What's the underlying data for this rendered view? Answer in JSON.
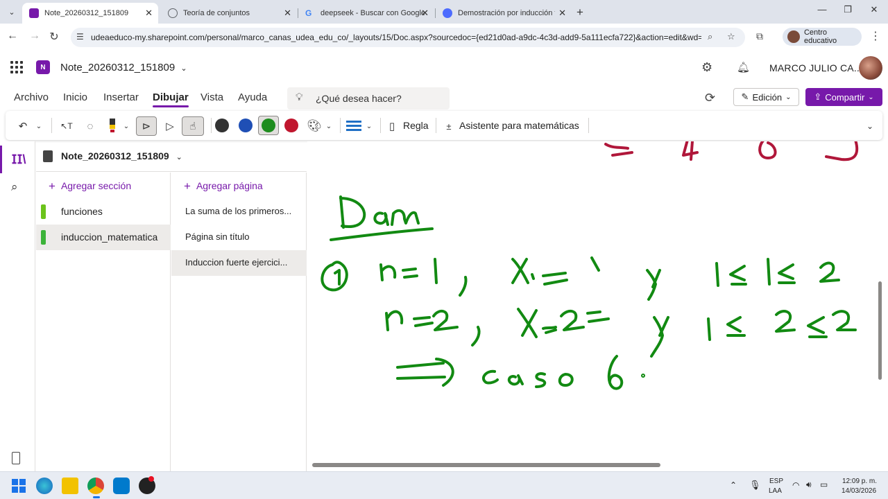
{
  "browser": {
    "tabs": [
      {
        "title": "Note_20260312_151809",
        "active": true,
        "favicon_color": "#7719aa"
      },
      {
        "title": "Teoría de conjuntos",
        "active": false,
        "favicon_color": "#5f6368"
      },
      {
        "title": "deepseek - Buscar con Google",
        "active": false,
        "favicon_color": "#4285f4"
      },
      {
        "title": "Demostración por inducción fu",
        "active": false,
        "favicon_color": "#4d6bfe"
      }
    ],
    "url": "udeaeduco-my.sharepoint.com/personal/marco_canas_udea_edu_co/_layouts/15/Doc.aspx?sourcedoc={ed21d0ad-a9dc-4c3d-add9-5a111ecfa722}&action=edit&wd=tar...",
    "profile_label": "Centro educativo"
  },
  "app": {
    "title": "Note_20260312_151809",
    "user_name": "MARCO JULIO CA...",
    "accent": "#7719aa"
  },
  "menu": {
    "items": [
      "Archivo",
      "Inicio",
      "Insertar",
      "Dibujar",
      "Vista",
      "Ayuda"
    ],
    "active": "Dibujar",
    "search_placeholder": "¿Qué desea hacer?",
    "edit_label": "Edición",
    "share_label": "Compartir"
  },
  "toolbar": {
    "ruler_label": "Regla",
    "math_label": "Asistente para matemáticas",
    "pen_colors": [
      "#333333",
      "#1f4fb5",
      "#1e8c1e",
      "#c0162e"
    ]
  },
  "notebook": {
    "name": "Note_20260312_151809",
    "add_section": "Agregar sección",
    "add_page": "Agregar página",
    "sections": [
      {
        "label": "funciones",
        "color": "#6bc31b",
        "selected": false
      },
      {
        "label": "induccion_matematica",
        "color": "#3cb339",
        "selected": true
      }
    ],
    "pages": [
      {
        "label": "La suma de los primeros...",
        "selected": false
      },
      {
        "label": "Página sin título",
        "selected": false
      },
      {
        "label": "Induccion fuerte ejercici...",
        "selected": true
      }
    ]
  },
  "taskbar": {
    "lang_line1": "ESP",
    "lang_line2": "LAA",
    "time": "12:09 p. m.",
    "date": "14/03/2026"
  },
  "ink_colors": {
    "green": "#128a12",
    "red": "#b0173a"
  }
}
